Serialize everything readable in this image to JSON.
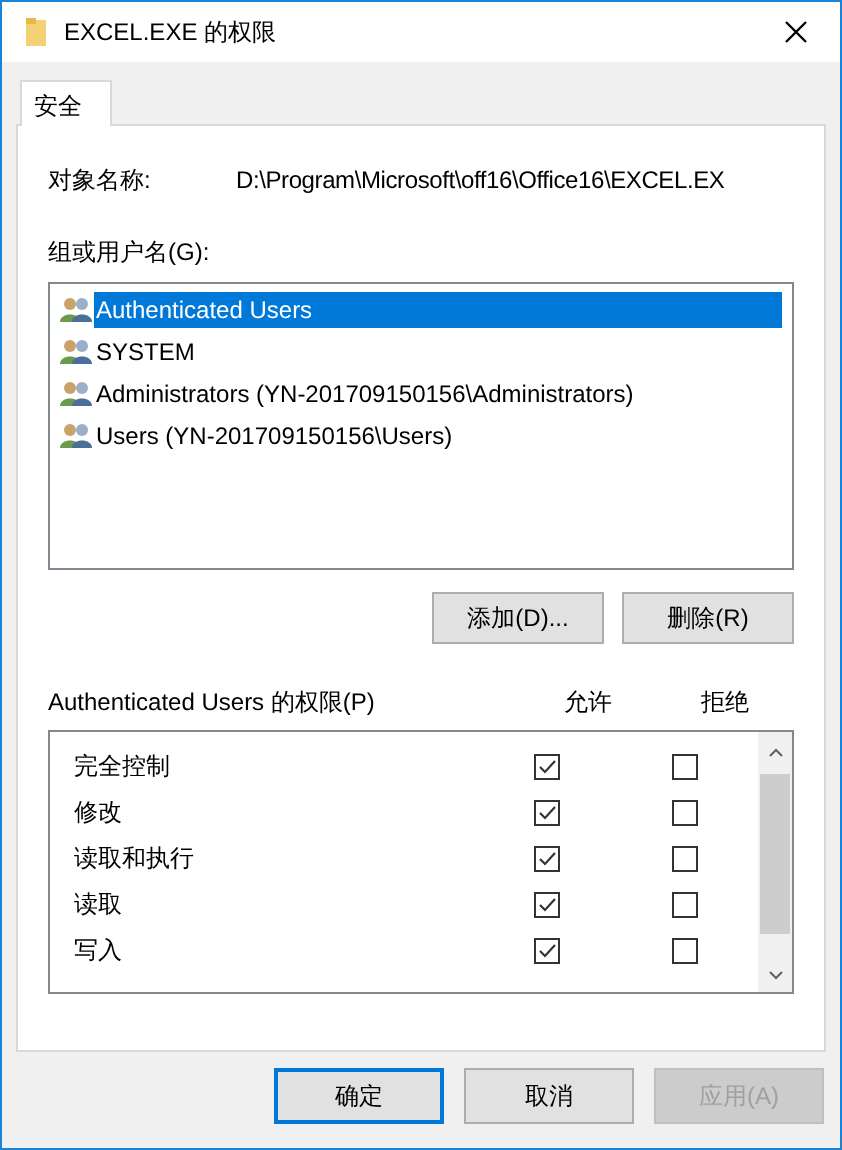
{
  "window": {
    "title": "EXCEL.EXE 的权限"
  },
  "tabs": [
    {
      "label": "安全",
      "selected": true
    }
  ],
  "object_name": {
    "label": "对象名称:",
    "value": "D:\\Program\\Microsoft\\off16\\Office16\\EXCEL.EX"
  },
  "groups": {
    "label": "组或用户名(G):",
    "items": [
      {
        "name": "Authenticated Users",
        "selected": true
      },
      {
        "name": "SYSTEM",
        "selected": false
      },
      {
        "name": "Administrators (YN-201709150156\\Administrators)",
        "selected": false
      },
      {
        "name": "Users (YN-201709150156\\Users)",
        "selected": false
      }
    ],
    "buttons": [
      {
        "label": "添加(D)..."
      },
      {
        "label": "删除(R)"
      }
    ]
  },
  "permissions": {
    "label": "Authenticated Users 的权限(P)",
    "allow_header": "允许",
    "deny_header": "拒绝",
    "rows": [
      {
        "name": "完全控制",
        "allow": true,
        "deny": false
      },
      {
        "name": "修改",
        "allow": true,
        "deny": false
      },
      {
        "name": "读取和执行",
        "allow": true,
        "deny": false
      },
      {
        "name": "读取",
        "allow": true,
        "deny": false
      },
      {
        "name": "写入",
        "allow": true,
        "deny": false
      }
    ]
  },
  "footer_buttons": [
    {
      "label": "确定",
      "default": true,
      "disabled": false
    },
    {
      "label": "取消",
      "default": false,
      "disabled": false
    },
    {
      "label": "应用(A)",
      "default": false,
      "disabled": true
    }
  ]
}
